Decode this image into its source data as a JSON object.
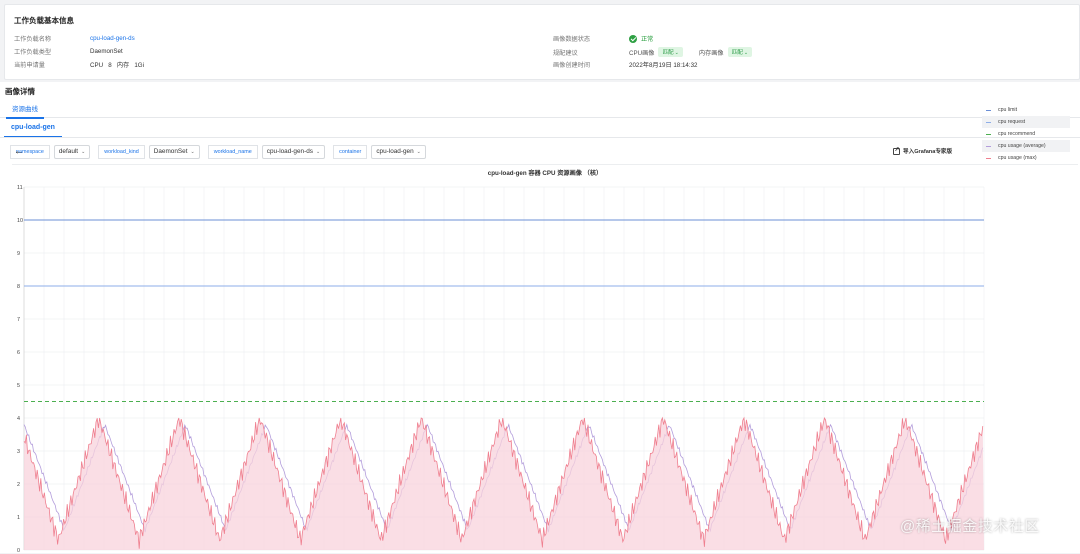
{
  "info_card": {
    "title": "工作负载基本信息",
    "left": [
      {
        "key": "工作负载名称",
        "value": "cpu-load-gen-ds",
        "link": true
      },
      {
        "key": "工作负载类型",
        "value": "DaemonSet",
        "link": false
      },
      {
        "key": "当前申请量",
        "value": "CPU   8   内存   1Gi",
        "link": false
      }
    ],
    "right": {
      "status_key": "画像数据状态",
      "status_value": "正常",
      "suggest_key": "规配建议",
      "cpu_label": "CPU画像",
      "cpu_tag": "匹配",
      "mem_label": "内存画像",
      "mem_tag": "匹配",
      "time_key": "画像创建时间",
      "time_value": "2022年8月19日 18:14:32"
    }
  },
  "section": {
    "title": "画像详情",
    "tab": "资源曲线",
    "subtab": "cpu-load-gen"
  },
  "filters": {
    "namespace_label": "namespace",
    "namespace_value": "default",
    "kind_label": "workload_kind",
    "kind_value": "DaemonSet",
    "name_label": "workload_name",
    "name_value": "cpu-load-gen-ds",
    "container_label": "container",
    "container_value": "cpu-load-gen",
    "export_label": "导入Grafana专家版"
  },
  "colors": {
    "accent": "#1a73e8",
    "ok": "#2ea043",
    "limit": "#6b8fd6",
    "request": "#8eaee8",
    "recommend": "#4caf50",
    "average": "#b39ddb",
    "max": "#ef7f8f"
  },
  "chart_data": {
    "type": "line",
    "title": "cpu-load-gen 容器 CPU 资源画像 （核）",
    "ylim": [
      0,
      11
    ],
    "y_ticks": [
      "0",
      "1",
      "2",
      "3",
      "4",
      "5",
      "6",
      "7",
      "8",
      "9",
      "10",
      "11"
    ],
    "grid": true,
    "legend_position": "right",
    "series": [
      {
        "name": "cpu limit",
        "color": "#6b8fd6",
        "style": "solid",
        "value": 10
      },
      {
        "name": "cpu request",
        "color": "#8eaee8",
        "style": "solid",
        "value": 8
      },
      {
        "name": "cpu recommend",
        "color": "#4caf50",
        "style": "dashed",
        "value": 4.5
      },
      {
        "name": "cpu usage (average)",
        "color": "#b39ddb",
        "style": "wave",
        "min": 0.6,
        "max": 3.8,
        "cycles": 11.9
      },
      {
        "name": "cpu usage (max)",
        "color": "#ef7f8f",
        "style": "wave-filled",
        "min": 0.3,
        "max": 4.0,
        "cycles": 11.9
      }
    ]
  },
  "watermark": "@稀土掘金技术社区"
}
